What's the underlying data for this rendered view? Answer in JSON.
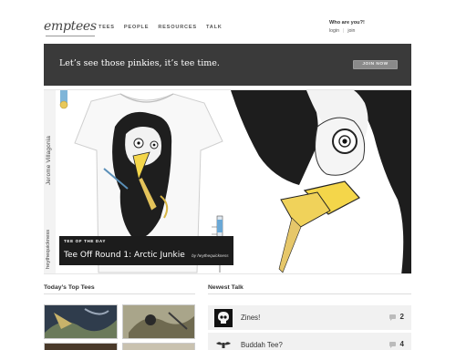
{
  "header": {
    "logo": "emptees",
    "nav": [
      "TEES",
      "PEOPLE",
      "RESOURCES",
      "TALK"
    ],
    "who_title": "Who are you?!",
    "login": "login",
    "join": "join"
  },
  "banner": {
    "text": "Let’s see those pinkies, it’s tee time.",
    "button": "JOIN NOW"
  },
  "feature": {
    "artist": "Jerome Villagonia",
    "tag": "heythequickness",
    "kicker": "TEE OF THE DAY",
    "title": "Tee Off Round 1: Arctic Junkie",
    "by": "by heythequickness"
  },
  "top_tees": {
    "title": "Today’s Top Tees"
  },
  "newest_talk": {
    "title": "Newest Talk",
    "items": [
      {
        "title": "Zines!",
        "count": "2",
        "avatar": "skull-icon"
      },
      {
        "title": "Buddah Tee?",
        "count": "4",
        "avatar": "wings-icon"
      }
    ]
  },
  "colors": {
    "banner_bg": "#3a3a3a",
    "button_bg": "#8a8a8a",
    "caption_bg": "#1c1c1c",
    "beak_yellow": "#f4d64a"
  }
}
